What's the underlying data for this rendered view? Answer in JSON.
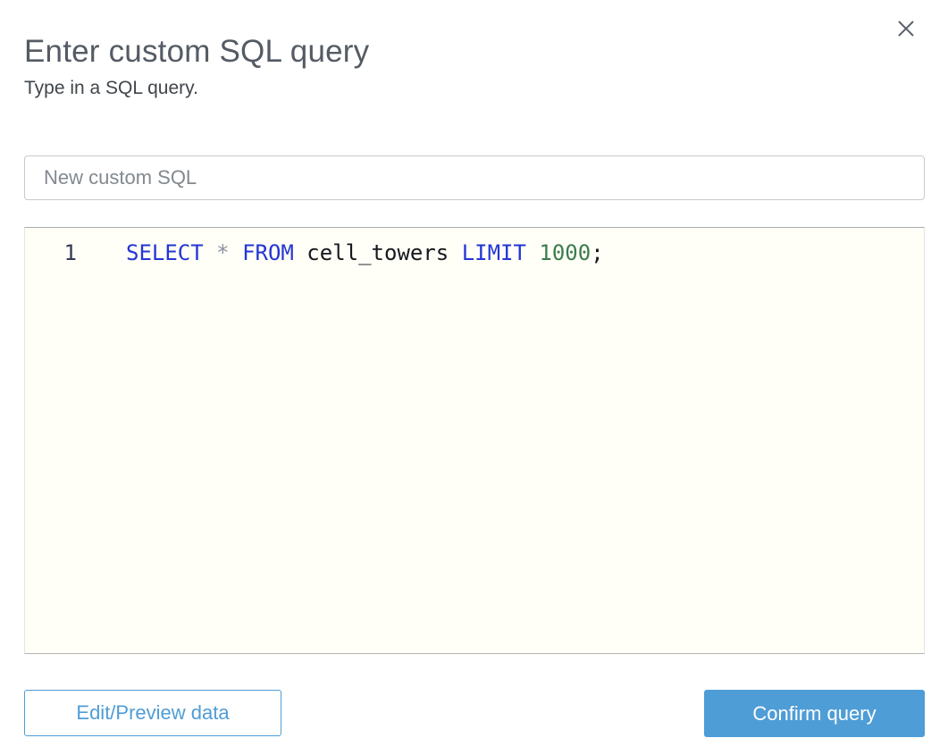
{
  "dialog": {
    "title": "Enter custom SQL query",
    "subtitle": "Type in a SQL query."
  },
  "name_input": {
    "value": "New custom SQL"
  },
  "editor": {
    "line_number": "1",
    "sql_text": "SELECT * FROM cell_towers LIMIT 1000;",
    "tokens": [
      {
        "text": "SELECT",
        "type": "keyword"
      },
      {
        "text": " ",
        "type": "plain"
      },
      {
        "text": "*",
        "type": "operator"
      },
      {
        "text": " ",
        "type": "plain"
      },
      {
        "text": "FROM",
        "type": "keyword"
      },
      {
        "text": " cell_towers ",
        "type": "plain"
      },
      {
        "text": "LIMIT",
        "type": "keyword"
      },
      {
        "text": " ",
        "type": "plain"
      },
      {
        "text": "1000",
        "type": "number"
      },
      {
        "text": ";",
        "type": "plain"
      }
    ]
  },
  "footer": {
    "edit_preview_label": "Edit/Preview data",
    "confirm_label": "Confirm query"
  },
  "icons": {
    "close": "close-icon"
  },
  "colors": {
    "accent_blue": "#4f9dd6",
    "keyword_blue": "#2336d4",
    "number_green": "#3a7d4c",
    "operator_gray": "#8b93a2",
    "identifier_black": "#16181d",
    "editor_background": "#fffef7",
    "title_gray": "#545b64"
  }
}
